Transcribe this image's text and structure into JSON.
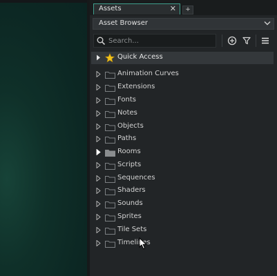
{
  "tabs": [
    {
      "label": "Assets",
      "active": true
    }
  ],
  "tab_add_label": "+",
  "browser_select": {
    "value": "Asset Browser"
  },
  "search": {
    "placeholder": "Search...",
    "value": ""
  },
  "toolbar": {
    "icons": [
      "add-icon",
      "filter-icon",
      "menu-icon"
    ]
  },
  "quick_access": {
    "label": "Quick Access",
    "icon": "star-icon"
  },
  "tree": {
    "items": [
      {
        "label": "Animation Curves",
        "expanded": false
      },
      {
        "label": "Extensions",
        "expanded": false
      },
      {
        "label": "Fonts",
        "expanded": false
      },
      {
        "label": "Notes",
        "expanded": false
      },
      {
        "label": "Objects",
        "expanded": false
      },
      {
        "label": "Paths",
        "expanded": false
      },
      {
        "label": "Rooms",
        "expanded": false,
        "highlighted": true
      },
      {
        "label": "Scripts",
        "expanded": false
      },
      {
        "label": "Sequences",
        "expanded": false
      },
      {
        "label": "Shaders",
        "expanded": false
      },
      {
        "label": "Sounds",
        "expanded": false
      },
      {
        "label": "Sprites",
        "expanded": false
      },
      {
        "label": "Tile Sets",
        "expanded": false
      },
      {
        "label": "Timelines",
        "expanded": false
      }
    ]
  },
  "colors": {
    "accent": "#3e9f8c",
    "panel_bg": "#222527",
    "viewport_bg": "#0c2723",
    "star": "#f2c21b"
  }
}
